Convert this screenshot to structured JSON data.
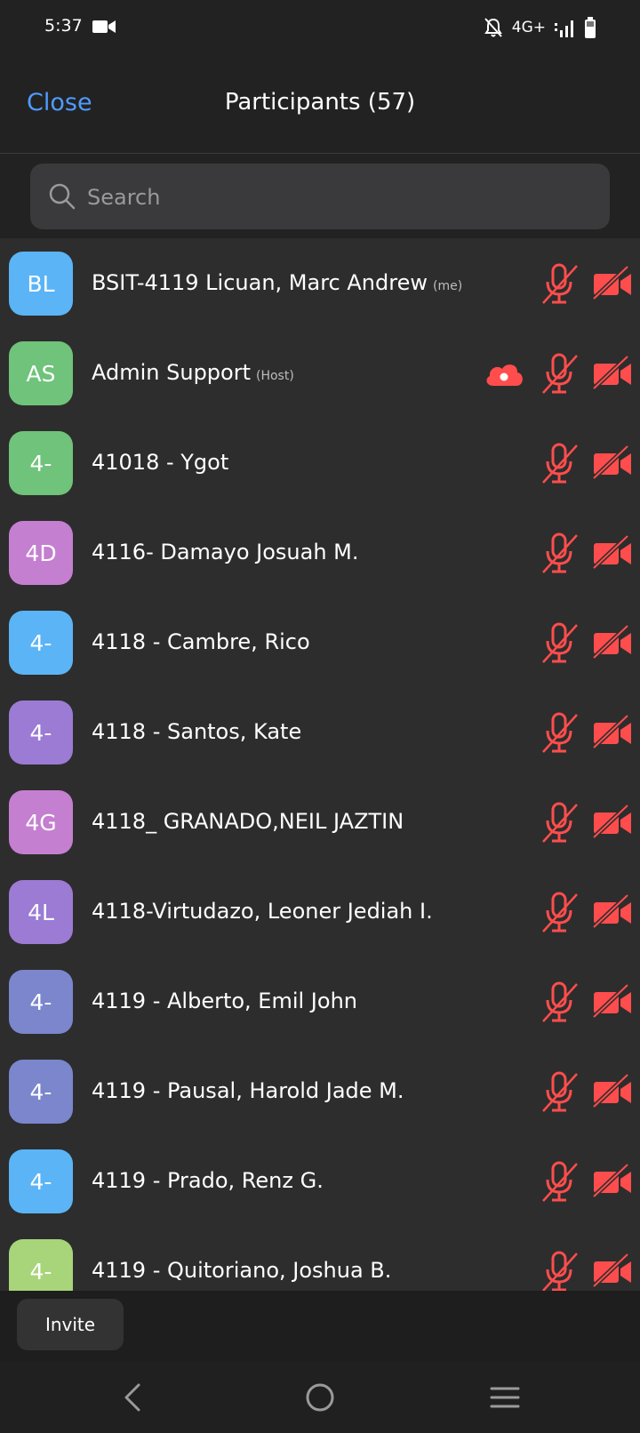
{
  "status_bar": {
    "time": "5:37",
    "network": "4G+",
    "icons": [
      "video-camera-icon",
      "bell-muted-icon",
      "signal-icon",
      "battery-icon"
    ]
  },
  "header": {
    "close_label": "Close",
    "title": "Participants (57)"
  },
  "search": {
    "placeholder": "Search"
  },
  "colors": {
    "accent": "#4f9bff",
    "muted_red": "#ff4d4d",
    "background": "#2d2d2d"
  },
  "participants": [
    {
      "initials": "BL",
      "name": "BSIT-4119 Licuan, Marc Andrew",
      "tag": "(me)",
      "color": "#5bb4f5",
      "cloud": false
    },
    {
      "initials": "AS",
      "name": "Admin Support",
      "tag": "(Host)",
      "color": "#6fc37a",
      "cloud": true
    },
    {
      "initials": "4-",
      "name": "41018 - Ygot",
      "tag": "",
      "color": "#6fc37a",
      "cloud": false
    },
    {
      "initials": "4D",
      "name": "4116- Damayo Josuah M.",
      "tag": "",
      "color": "#c47fd0",
      "cloud": false
    },
    {
      "initials": "4-",
      "name": "4118 - Cambre, Rico",
      "tag": "",
      "color": "#5bb4f5",
      "cloud": false
    },
    {
      "initials": "4-",
      "name": "4118 - Santos, Kate",
      "tag": "",
      "color": "#9b7bd4",
      "cloud": false
    },
    {
      "initials": "4G",
      "name": "4118_ GRANADO,NEIL JAZTIN",
      "tag": "",
      "color": "#c47fd0",
      "cloud": false
    },
    {
      "initials": "4L",
      "name": "4118-Virtudazo, Leoner Jediah I.",
      "tag": "",
      "color": "#9b7bd4",
      "cloud": false
    },
    {
      "initials": "4-",
      "name": "4119 - Alberto, Emil John",
      "tag": "",
      "color": "#7b86cc",
      "cloud": false
    },
    {
      "initials": "4-",
      "name": "4119 - Pausal, Harold Jade M.",
      "tag": "",
      "color": "#7b86cc",
      "cloud": false
    },
    {
      "initials": "4-",
      "name": "4119 - Prado, Renz G.",
      "tag": "",
      "color": "#5bb4f5",
      "cloud": false
    },
    {
      "initials": "4-",
      "name": "4119 - Quitoriano, Joshua B.",
      "tag": "",
      "color": "#a8d47a",
      "cloud": false
    }
  ],
  "footer": {
    "invite_label": "Invite"
  },
  "nav": [
    "back-icon",
    "home-icon",
    "recents-icon"
  ]
}
